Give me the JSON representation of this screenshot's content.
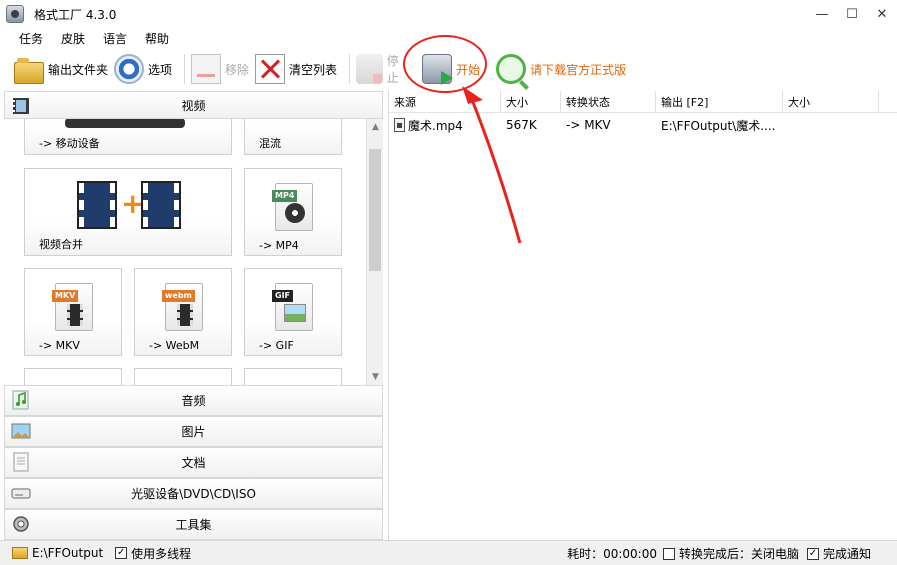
{
  "window": {
    "title": "格式工厂 4.3.0",
    "controls": {
      "minimize": "—",
      "maximize": "☐",
      "close": "✕"
    }
  },
  "menu": [
    "任务",
    "皮肤",
    "语言",
    "帮助"
  ],
  "toolbar": {
    "output_folder": "输出文件夹",
    "options": "选项",
    "remove": "移除",
    "clear_list": "清空列表",
    "stop": "停止",
    "start": "开始",
    "download": "请下载官方正式版"
  },
  "left_panel": {
    "video_category": "视频",
    "tiles": {
      "mobile": "-> 移动设备",
      "mix": "混流",
      "merge": "视频合并",
      "mp4": "-> MP4",
      "mkv": "-> MKV",
      "webm": "-> WebM",
      "gif": "-> GIF"
    },
    "badges": {
      "mp4": "MP4",
      "mkv": "MKV",
      "webm": "webm",
      "gif": "GIF"
    },
    "categories": [
      {
        "label": "音频",
        "icon": "music-note-icon"
      },
      {
        "label": "图片",
        "icon": "picture-icon"
      },
      {
        "label": "文档",
        "icon": "document-icon"
      },
      {
        "label": "光驱设备\\DVD\\CD\\ISO",
        "icon": "optical-drive-icon"
      },
      {
        "label": "工具集",
        "icon": "tools-icon"
      }
    ]
  },
  "task_list": {
    "columns": [
      "来源",
      "大小",
      "转换状态",
      "输出 [F2]",
      "大小"
    ],
    "rows": [
      {
        "source": "魔术.mp4",
        "size": "567K",
        "status": "-> MKV",
        "output": "E:\\FFOutput\\魔术....",
        "out_size": ""
      }
    ]
  },
  "status_bar": {
    "output_path": "E:\\FFOutput",
    "multithread_label": "使用多线程",
    "multithread_checked": "✓",
    "elapsed": "耗时：00:00:00",
    "after_convert_label": "转换完成后：关闭电脑",
    "after_convert_checked": "",
    "notify_label": "完成通知",
    "notify_checked": "✓"
  },
  "colors": {
    "annotation": "#e8231b",
    "start_label": "#e0640a",
    "disabled_text": "#a8a8a8"
  }
}
